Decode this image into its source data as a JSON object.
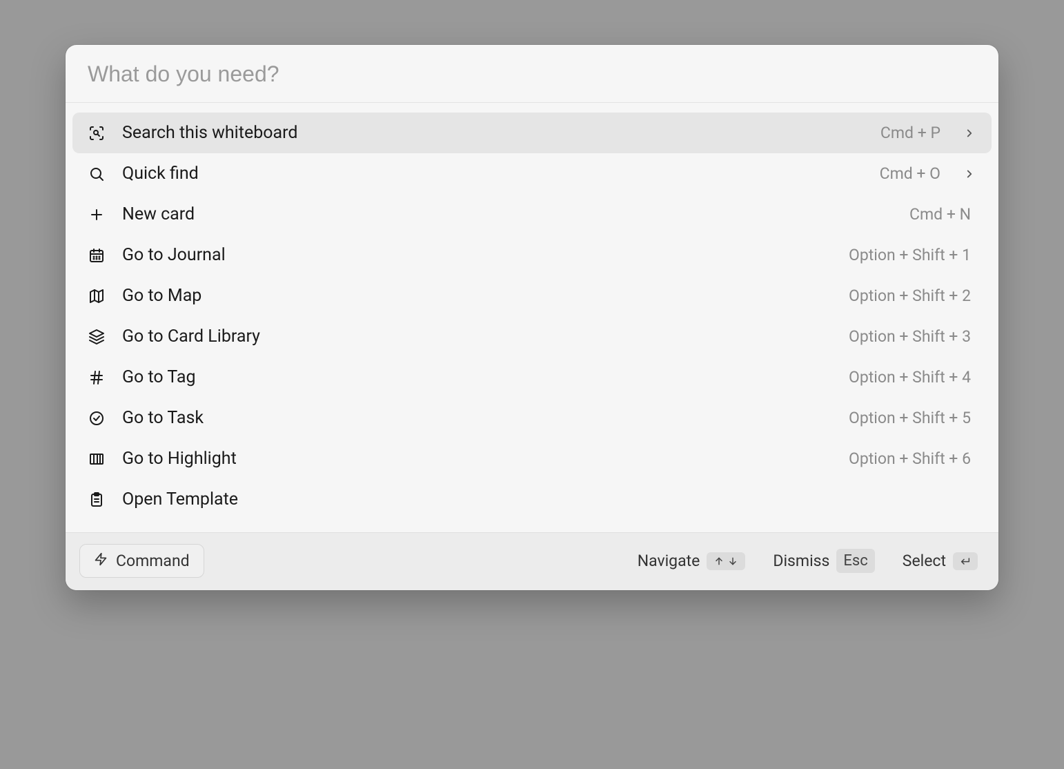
{
  "search": {
    "placeholder": "What do you need?",
    "value": ""
  },
  "items": [
    {
      "id": "search-whiteboard",
      "icon": "scan-search-icon",
      "label": "Search this whiteboard",
      "shortcut": "Cmd + P",
      "chevron": true,
      "selected": true
    },
    {
      "id": "quick-find",
      "icon": "search-icon",
      "label": "Quick find",
      "shortcut": "Cmd + O",
      "chevron": true,
      "selected": false
    },
    {
      "id": "new-card",
      "icon": "plus-icon",
      "label": "New card",
      "shortcut": "Cmd + N",
      "chevron": false,
      "selected": false
    },
    {
      "id": "go-journal",
      "icon": "calendar-icon",
      "label": "Go to Journal",
      "shortcut": "Option + Shift + 1",
      "chevron": false,
      "selected": false
    },
    {
      "id": "go-map",
      "icon": "map-icon",
      "label": "Go to Map",
      "shortcut": "Option + Shift + 2",
      "chevron": false,
      "selected": false
    },
    {
      "id": "go-card-library",
      "icon": "layers-icon",
      "label": "Go to Card Library",
      "shortcut": "Option + Shift + 3",
      "chevron": false,
      "selected": false
    },
    {
      "id": "go-tag",
      "icon": "hash-icon",
      "label": "Go to Tag",
      "shortcut": "Option + Shift + 4",
      "chevron": false,
      "selected": false
    },
    {
      "id": "go-task",
      "icon": "check-circle-icon",
      "label": "Go to Task",
      "shortcut": "Option + Shift + 5",
      "chevron": false,
      "selected": false
    },
    {
      "id": "go-highlight",
      "icon": "highlight-icon",
      "label": "Go to Highlight",
      "shortcut": "Option + Shift + 6",
      "chevron": false,
      "selected": false
    },
    {
      "id": "open-template",
      "icon": "clipboard-icon",
      "label": "Open Template",
      "shortcut": "",
      "chevron": false,
      "selected": false
    }
  ],
  "footer": {
    "command_label": "Command",
    "navigate_label": "Navigate",
    "dismiss_label": "Dismiss",
    "dismiss_key": "Esc",
    "select_label": "Select"
  }
}
